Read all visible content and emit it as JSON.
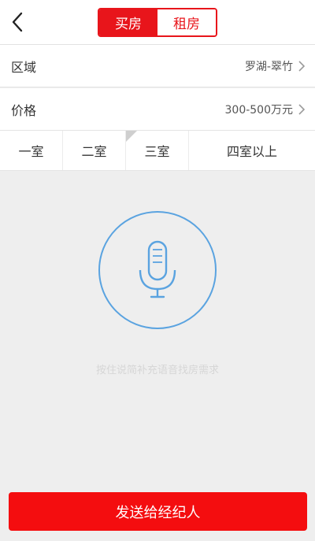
{
  "header": {
    "back_icon": "chevron-left-icon",
    "tabs": [
      {
        "label": "买房",
        "active": true
      },
      {
        "label": "租房",
        "active": false
      }
    ]
  },
  "filters": {
    "area": {
      "label": "区域",
      "value": "罗湖-翠竹"
    },
    "price": {
      "label": "价格",
      "value": "300-500万元"
    }
  },
  "rooms": [
    "一室",
    "二室",
    "三室",
    "四室以上"
  ],
  "voice": {
    "icon": "microphone-icon",
    "hint": "按住说简补充语音找房需求"
  },
  "submit_label": "发送给经纪人",
  "colors": {
    "accent": "#e8151b",
    "mic_ring": "#5aa3e0",
    "background": "#eeeeee"
  }
}
